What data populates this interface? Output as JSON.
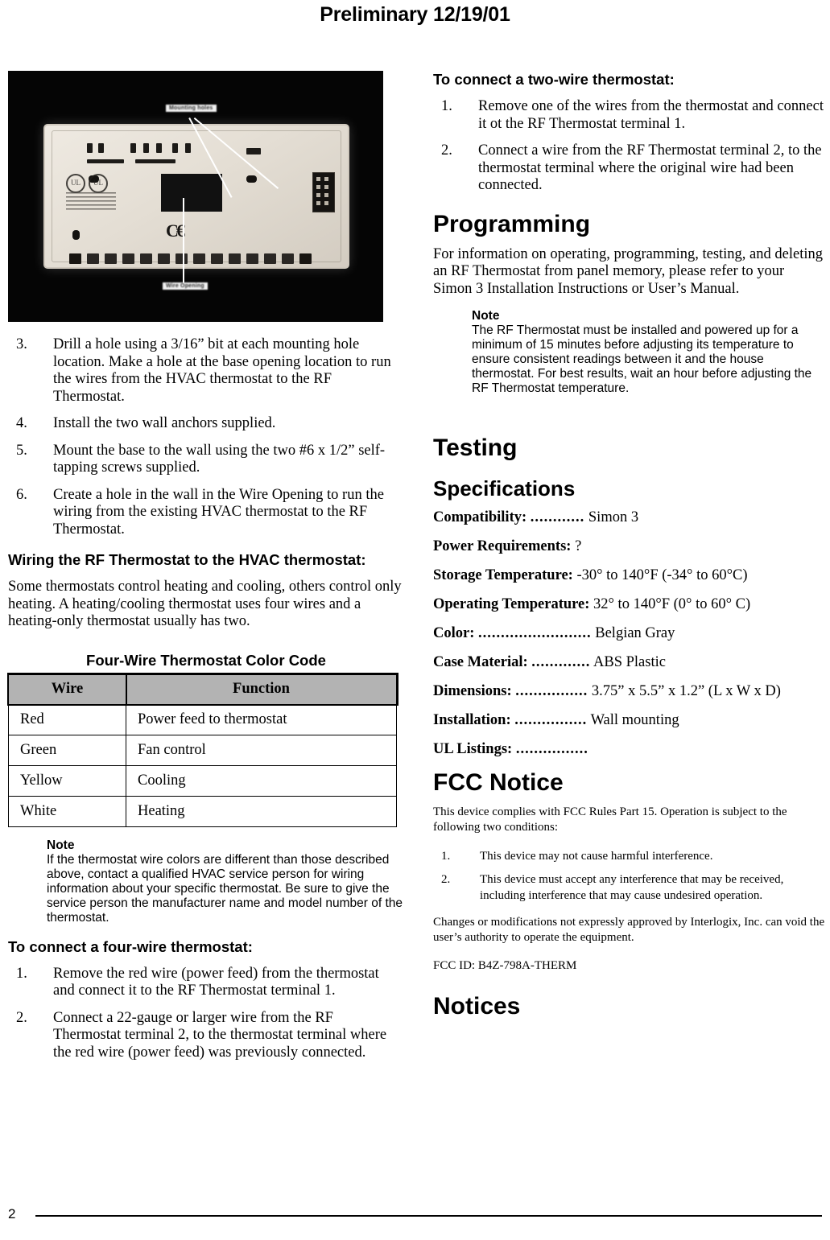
{
  "header": {
    "title": "Preliminary 12/19/01"
  },
  "figure": {
    "alt": "rf-thermostat-back-photo",
    "callouts": [
      {
        "label": "Mounting holes"
      },
      {
        "label": "Wire Opening"
      }
    ],
    "marks": {
      "ce": "CE",
      "ul_left": "UL",
      "ul_right": "UL"
    }
  },
  "left_column": {
    "steps_continued": [
      {
        "n": "3.",
        "text": "Drill a hole using a 3/16” bit at each mounting hole location. Make a hole at the base opening location to run the wires from the HVAC thermostat to the RF Thermostat."
      },
      {
        "n": "4.",
        "text": "Install the two wall anchors supplied."
      },
      {
        "n": "5.",
        "text": "Mount the base to the wall using the two #6 x 1/2” self-tapping screws supplied."
      },
      {
        "n": "6.",
        "text": "Create a hole in the wall in the Wire Opening to run the wiring from the existing HVAC thermostat to the RF Thermostat."
      }
    ],
    "wiring_heading": "Wiring the RF Thermostat to the HVAC thermostat:",
    "wiring_paragraph": "Some thermostats control heating and cooling, others control only heating. A heating/cooling thermostat uses four wires and a heating-only thermostat usually has two.",
    "table": {
      "title": "Four-Wire Thermostat Color Code",
      "columns": [
        "Wire",
        "Function"
      ],
      "rows": [
        [
          "Red",
          "Power feed to thermostat"
        ],
        [
          "Green",
          "Fan control"
        ],
        [
          "Yellow",
          "Cooling"
        ],
        [
          "White",
          "Heating"
        ]
      ]
    },
    "note": {
      "title": "Note",
      "text": "If the thermostat wire colors are different than those described above, contact a qualified HVAC service person for wiring information about your specific thermostat. Be sure to give the service person the manufacturer name and model number of the thermostat."
    },
    "four_wire_heading": "To connect a four-wire thermostat:",
    "four_wire_steps": [
      {
        "n": "1.",
        "text": "Remove the red wire (power feed) from the thermostat and connect it to the RF Thermostat terminal 1."
      },
      {
        "n": "2.",
        "text": "Connect a 22-gauge or larger wire from the RF Thermostat terminal 2, to the thermostat terminal where the red wire (power feed) was previously connected."
      }
    ]
  },
  "right_column": {
    "two_wire_heading": "To connect a two-wire thermostat:",
    "two_wire_steps": [
      {
        "n": "1.",
        "text": "Remove one of the wires from the thermostat and connect it ot the RF Thermostat terminal 1."
      },
      {
        "n": "2.",
        "text": "Connect a wire from the RF Thermostat terminal 2, to the thermostat terminal where the original wire had been connected."
      }
    ],
    "programming": {
      "heading": "Programming",
      "paragraph": "For information on operating, programming, testing, and deleting an RF Thermostat from panel memory, please refer to your Simon 3 Installation Instructions or User’s Manual.",
      "note": {
        "title": "Note",
        "text": "The RF Thermostat must be installed and powered up for a minimum of 15 minutes before adjusting its temperature to ensure consistent readings between it and the house thermostat. For best results, wait an hour before adjusting the RF Thermostat temperature."
      }
    },
    "testing_heading": "Testing",
    "specifications_heading": "Specifications",
    "specifications": [
      {
        "label": "Compatibility:",
        "dots": "............",
        "value": "Simon 3"
      },
      {
        "label": "Power Requirements:",
        "dots": "",
        "value": "?"
      },
      {
        "label": "Storage Temperature:",
        "dots": "",
        "value": "-30° to 140°F (-34° to 60°C)"
      },
      {
        "label": "Operating Temperature:",
        "dots": "",
        "value": "32° to 140°F (0° to 60° C)"
      },
      {
        "label": "Color:",
        "dots": ".........................",
        "value": "Belgian Gray"
      },
      {
        "label": "Case Material:",
        "dots": ".............",
        "value": "ABS Plastic"
      },
      {
        "label": "Dimensions:",
        "dots": "................",
        "value": "3.75” x 5.5” x 1.2” (L x W x D)"
      },
      {
        "label": "Installation:",
        "dots": "................",
        "value": "Wall mounting"
      },
      {
        "label": "UL Listings:",
        "dots": "................",
        "value": ""
      }
    ],
    "fcc": {
      "heading": "FCC Notice",
      "intro": "This device complies with FCC Rules Part 15. Operation is subject to the following two conditions:",
      "conditions": [
        {
          "n": "1.",
          "text": "This device may not cause harmful interference."
        },
        {
          "n": "2.",
          "text": "This device must accept any interference that may be received, including interference that may cause undesired operation."
        }
      ],
      "changes": "Changes or modifications not expressly approved by Interlogix, Inc. can void the user’s authority to operate the equipment.",
      "fcc_id": "FCC ID: B4Z-798A-THERM"
    },
    "notices_heading": "Notices"
  },
  "footer": {
    "page_number": "2"
  }
}
